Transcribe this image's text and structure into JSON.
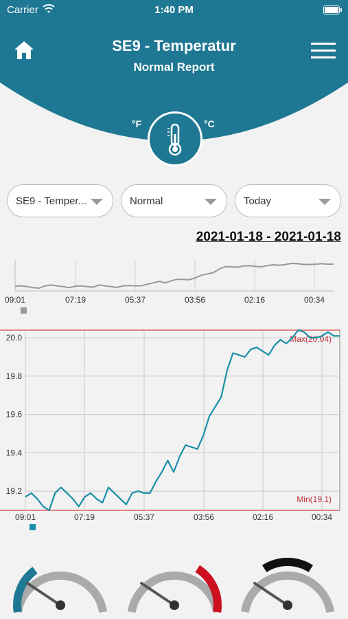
{
  "status_bar": {
    "carrier": "Carrier",
    "time": "1:40 PM"
  },
  "header": {
    "title": "SE9 - Temperatur",
    "subtitle": "Normal Report",
    "unit_f": "°F",
    "unit_c": "°C"
  },
  "colors": {
    "primary": "#1f7893",
    "line": "#1a8fa8",
    "limit": "#e06060",
    "overview": "#999999"
  },
  "dropdowns": [
    {
      "value": "SE9 - Temper..."
    },
    {
      "value": "Normal"
    },
    {
      "value": "Today"
    }
  ],
  "date_range": "2021-01-18 - 2021-01-18",
  "overview_chart": {
    "x_labels": [
      "09:01",
      "07:19",
      "05:37",
      "03:56",
      "02:16",
      "00:34"
    ]
  },
  "chart_data": {
    "type": "line",
    "x_labels": [
      "09:01",
      "07:19",
      "05:37",
      "03:56",
      "02:16",
      "00:34"
    ],
    "y_ticks": [
      "20.0",
      "19.8",
      "19.6",
      "19.4",
      "19.2"
    ],
    "ylim": [
      19.1,
      20.04
    ],
    "max_label": "Max(20.04)",
    "min_label": "Min(19.1)",
    "max_value": 20.04,
    "min_value": 19.1,
    "series": [
      {
        "values": [
          19.17,
          19.19,
          19.16,
          19.12,
          19.1,
          19.19,
          19.22,
          19.19,
          19.16,
          19.12,
          19.17,
          19.19,
          19.16,
          19.14,
          19.22,
          19.19,
          19.16,
          19.13,
          19.19,
          19.2,
          19.19,
          19.19,
          19.25,
          19.3,
          19.36,
          19.3,
          19.38,
          19.44,
          19.43,
          19.42,
          19.49,
          19.59,
          19.64,
          19.69,
          19.83,
          19.92,
          19.91,
          19.9,
          19.94,
          19.95,
          19.93,
          19.91,
          19.96,
          19.99,
          19.97,
          20.0,
          20.04,
          20.03,
          20.0,
          20.0,
          20.01,
          20.03,
          20.01,
          20.01
        ]
      }
    ]
  },
  "gauges": [
    {
      "name": "gauge-1",
      "accent": "#1f7893",
      "segment": "left"
    },
    {
      "name": "gauge-2",
      "accent": "#cc1020",
      "segment": "right"
    },
    {
      "name": "gauge-3",
      "accent": "#111111",
      "segment": "top"
    }
  ]
}
